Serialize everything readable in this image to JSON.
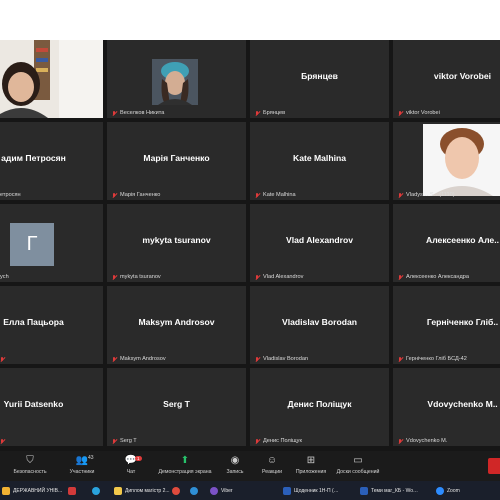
{
  "tiles": [
    {
      "label": "",
      "center": ""
    },
    {
      "label": "Веселков Никита",
      "center": ""
    },
    {
      "label": "Брянцев",
      "center": "Брянцев"
    },
    {
      "label": "viktor Vorobei",
      "center": "viktor Vorobei"
    },
    {
      "label": "етросян",
      "center": "адим Петросян"
    },
    {
      "label": "Марія Ганченко",
      "center": "Марія Ганченко"
    },
    {
      "label": "Kate Malhina",
      "center": "Kate Malhina"
    },
    {
      "label": "Vladys… Ѕ…(1110)",
      "center": ""
    },
    {
      "label": "ych",
      "center": ""
    },
    {
      "label": "mykyta tsuranov",
      "center": "mykyta tsuranov"
    },
    {
      "label": "Vlad Alexandrov",
      "center": "Vlad Alexandrov"
    },
    {
      "label": "Алексеенко Александра",
      "center": "Алексеенко Але.."
    },
    {
      "label": "",
      "center": "Елла Пацьора"
    },
    {
      "label": "Maksym Androsov",
      "center": "Maksym Androsov"
    },
    {
      "label": "Vladislav Borodan",
      "center": "Vladislav Borodan"
    },
    {
      "label": "Герніченко Гліб БСД-42",
      "center": "Герніченко Гліб.."
    },
    {
      "label": "",
      "center": "Yurii Datsenko"
    },
    {
      "label": "Serg T",
      "center": "Serg T"
    },
    {
      "label": "Денис Поліщук",
      "center": "Денис Поліщук"
    },
    {
      "label": "Vdovychenko M.",
      "center": "Vdovychenko M.."
    }
  ],
  "avatar_letter": "Г",
  "controls": {
    "security": "Безопасность",
    "participants": "Участники",
    "participants_count": "43",
    "chat": "Чат",
    "chat_badge": "1",
    "share": "Демонстрация экрана",
    "record": "Запись",
    "reactions": "Реакции",
    "apps": "Приложения",
    "whiteboard": "Доски сообщений"
  },
  "taskbar": {
    "items": [
      {
        "label": "ДЕРЖАВНИЙ УНІВ...",
        "icon": "folder-icon",
        "color": "#f2b233"
      },
      {
        "label": "",
        "icon": "app-icon",
        "color": "#d23a3a"
      },
      {
        "label": "",
        "icon": "telegram-icon",
        "color": "#2aa3dd"
      },
      {
        "label": "Диплом магістр 2...",
        "icon": "folder-icon",
        "color": "#f2c84b"
      },
      {
        "label": "",
        "icon": "chrome-icon",
        "color": "#e04b3d"
      },
      {
        "label": "",
        "icon": "edge-icon",
        "color": "#2f8fd6"
      },
      {
        "label": "Viber",
        "icon": "viber-icon",
        "color": "#7b52c7"
      },
      {
        "label": "Щоденник 1Н-П (…",
        "icon": "word-icon",
        "color": "#2b5fb9"
      },
      {
        "label": "Теми маг_КБ - Wo…",
        "icon": "word-icon",
        "color": "#2b5fb9"
      },
      {
        "label": "Zoom",
        "icon": "zoom-icon",
        "color": "#2d8cff"
      }
    ]
  },
  "colors": {
    "tile_bg": "#2a2a2a",
    "stage_bg": "#161616",
    "mute_red": "#e03a3a",
    "share_green": "#27c26b",
    "end_red": "#d02727"
  }
}
